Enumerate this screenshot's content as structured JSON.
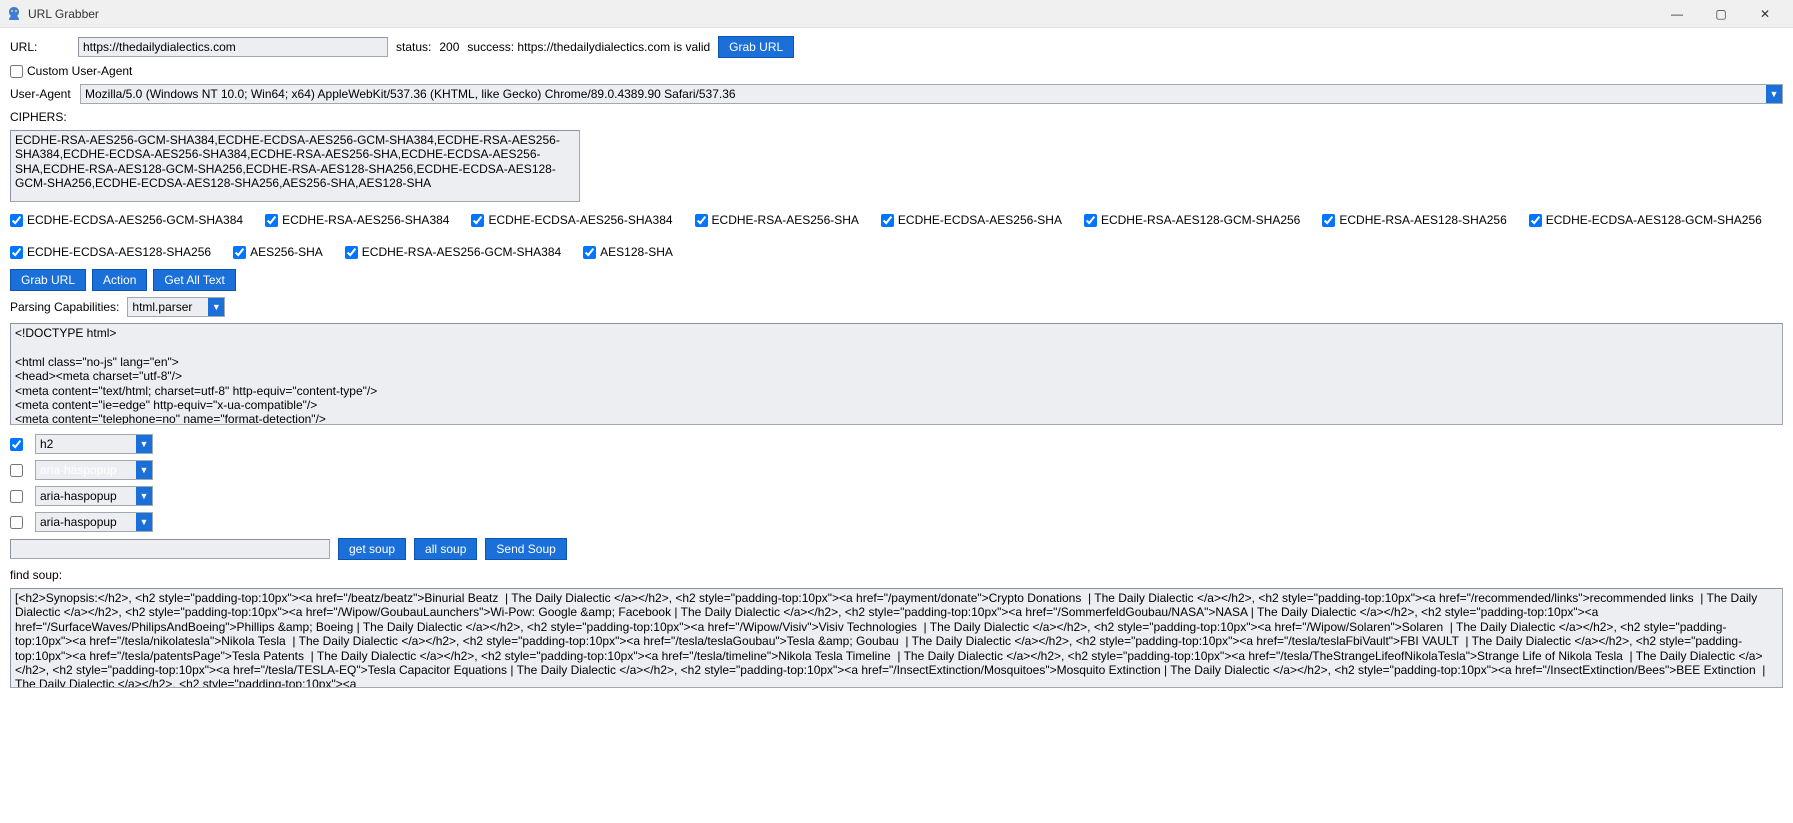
{
  "window": {
    "title": "URL Grabber",
    "min": "—",
    "max": "▢",
    "close": "✕"
  },
  "url_row": {
    "label": "URL:",
    "value": "https://thedailydialectics.com",
    "status_label": "status:",
    "status_code": "200",
    "success_label": "success: https://thedailydialectics.com is valid",
    "grab_btn": "Grab URL"
  },
  "custom_ua": {
    "checkbox_label": "Custom User-Agent"
  },
  "ua_row": {
    "label": "User-Agent",
    "value": "Mozilla/5.0 (Windows NT 10.0; Win64; x64) AppleWebKit/537.36 (KHTML, like Gecko) Chrome/89.0.4389.90 Safari/537.36"
  },
  "ciphers": {
    "label": "CIPHERS:",
    "text": "ECDHE-RSA-AES256-GCM-SHA384,ECDHE-ECDSA-AES256-GCM-SHA384,ECDHE-RSA-AES256-SHA384,ECDHE-ECDSA-AES256-SHA384,ECDHE-RSA-AES256-SHA,ECDHE-ECDSA-AES256-SHA,ECDHE-RSA-AES128-GCM-SHA256,ECDHE-RSA-AES128-SHA256,ECDHE-ECDSA-AES128-GCM-SHA256,ECDHE-ECDSA-AES128-SHA256,AES256-SHA,AES128-SHA",
    "items": [
      "ECDHE-ECDSA-AES256-GCM-SHA384",
      "ECDHE-RSA-AES256-SHA384",
      "ECDHE-ECDSA-AES256-SHA384",
      "ECDHE-RSA-AES256-SHA",
      "ECDHE-ECDSA-AES256-SHA",
      "ECDHE-RSA-AES128-GCM-SHA256",
      "ECDHE-RSA-AES128-SHA256",
      "ECDHE-ECDSA-AES128-GCM-SHA256",
      "ECDHE-ECDSA-AES128-SHA256",
      "AES256-SHA",
      "ECDHE-RSA-AES256-GCM-SHA384",
      "AES128-SHA"
    ]
  },
  "action_buttons": {
    "grab": "Grab URL",
    "action": "Action",
    "get_all": "Get All Text"
  },
  "parsing": {
    "label": "Parsing Capabilities:",
    "value": "html.parser"
  },
  "html_source": "<!DOCTYPE html>\n\n<html class=\"no-js\" lang=\"en\">\n<head><meta charset=\"utf-8\"/>\n<meta content=\"text/html; charset=utf-8\" http-equiv=\"content-type\"/>\n<meta content=\"ie=edge\" http-equiv=\"x-ua-compatible\"/>\n<meta content=\"telephone=no\" name=\"format-detection\"/>",
  "filters": [
    {
      "checked": true,
      "value": "h2",
      "selected": false
    },
    {
      "checked": false,
      "value": "aria-haspopup",
      "selected": true
    },
    {
      "checked": false,
      "value": "aria-haspopup",
      "selected": false
    },
    {
      "checked": false,
      "value": "aria-haspopup",
      "selected": false
    }
  ],
  "soup_buttons": {
    "get": "get soup",
    "all": "all soup",
    "send": "Send Soup"
  },
  "find_soup": {
    "label": "find soup:",
    "text": "[<h2>Synopsis:</h2>, <h2 style=\"padding-top:10px\"><a href=\"/beatz/beatz\">Binurial Beatz  | The Daily Dialectic </a></h2>, <h2 style=\"padding-top:10px\"><a href=\"/payment/donate\">Crypto Donations  | The Daily Dialectic </a></h2>, <h2 style=\"padding-top:10px\"><a href=\"/recommended/links\">recommended links  | The Daily Dialectic </a></h2>, <h2 style=\"padding-top:10px\"><a href=\"/Wipow/GoubauLaunchers\">Wi-Pow: Google &amp; Facebook | The Daily Dialectic </a></h2>, <h2 style=\"padding-top:10px\"><a href=\"/SommerfeldGoubau/NASA\">NASA | The Daily Dialectic </a></h2>, <h2 style=\"padding-top:10px\"><a href=\"/SurfaceWaves/PhilipsAndBoeing\">Phillips &amp; Boeing | The Daily Dialectic </a></h2>, <h2 style=\"padding-top:10px\"><a href=\"/Wipow/Visiv\">Visiv Technologies  | The Daily Dialectic </a></h2>, <h2 style=\"padding-top:10px\"><a href=\"/Wipow/Solaren\">Solaren  | The Daily Dialectic </a></h2>, <h2 style=\"padding-top:10px\"><a href=\"/tesla/nikolatesla\">Nikola Tesla  | The Daily Dialectic </a></h2>, <h2 style=\"padding-top:10px\"><a href=\"/tesla/teslaGoubau\">Tesla &amp; Goubau  | The Daily Dialectic </a></h2>, <h2 style=\"padding-top:10px\"><a href=\"/tesla/teslaFbiVault\">FBI VAULT  | The Daily Dialectic </a></h2>, <h2 style=\"padding-top:10px\"><a href=\"/tesla/patentsPage\">Tesla Patents  | The Daily Dialectic </a></h2>, <h2 style=\"padding-top:10px\"><a href=\"/tesla/timeline\">Nikola Tesla Timeline  | The Daily Dialectic </a></h2>, <h2 style=\"padding-top:10px\"><a href=\"/tesla/TheStrangeLifeofNikolaTesla\">Strange Life of Nikola Tesla  | The Daily Dialectic </a></h2>, <h2 style=\"padding-top:10px\"><a href=\"/tesla/TESLA-EQ\">Tesla Capacitor Equations | The Daily Dialectic </a></h2>, <h2 style=\"padding-top:10px\"><a href=\"/InsectExtinction/Mosquitoes\">Mosquito Extinction | The Daily Dialectic </a></h2>, <h2 style=\"padding-top:10px\"><a href=\"/InsectExtinction/Bees\">BEE Extinction  | The Daily Dialectic </a></h2>, <h2 style=\"padding-top:10px\"><a"
  }
}
